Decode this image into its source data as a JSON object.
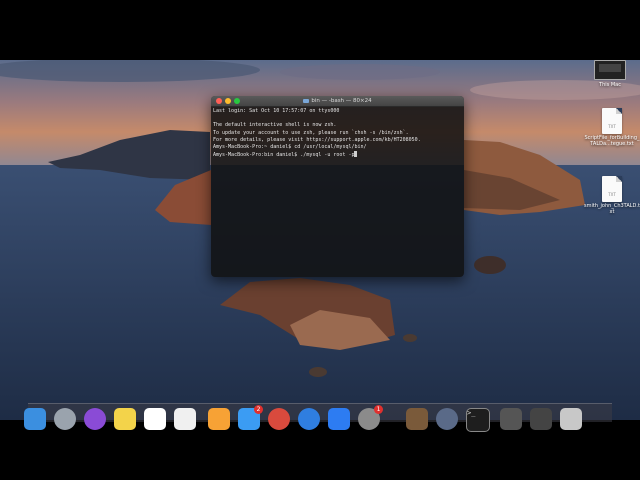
{
  "terminal": {
    "title": "bin — -bash — 80×24",
    "lines": [
      "Last login: Sat Oct 10 17:57:07 on ttys000",
      "",
      "The default interactive shell is now zsh.",
      "To update your account to use zsh, please run `chsh -s /bin/zsh`.",
      "For more details, please visit https://support.apple.com/kb/HT208050.",
      "Amys-MacBook-Pro:~ daniel$ cd /usr/local/mysql/bin/",
      "Amys-MacBook-Pro:bin daniel$ ./mysql -u root -p"
    ]
  },
  "desktop_icons": [
    {
      "label": "This Mac",
      "icon": "computer-icon"
    },
    {
      "label": "ScriptFile_forBuilding_TALDa...tegue.txt",
      "icon": "text-file-icon",
      "badge": "TXT"
    },
    {
      "label": "smith_john_Ch3TALD.txt",
      "icon": "text-file-icon",
      "badge": "TXT"
    }
  ],
  "dock": {
    "items": [
      {
        "name": "finder",
        "color": "#3b8fe0"
      },
      {
        "name": "launchpad",
        "color": "#9aa3ad"
      },
      {
        "name": "siri",
        "color": "#8a4bd6"
      },
      {
        "name": "notes",
        "color": "#f3d34a"
      },
      {
        "name": "calendar",
        "color": "#ffffff"
      },
      {
        "name": "reminders",
        "color": "#f0f0f0"
      },
      {
        "name": "photos",
        "color": "#f7a235"
      },
      {
        "name": "messages",
        "color": "#3b9cf3",
        "badge": "2"
      },
      {
        "name": "chrome",
        "color": "#d94a3d"
      },
      {
        "name": "safari",
        "color": "#2f7ee0"
      },
      {
        "name": "app-store",
        "color": "#2d7cf2"
      },
      {
        "name": "system-preferences",
        "color": "#8b8b8b",
        "badge": "1"
      },
      {
        "name": "utility",
        "color": "#7a5a3a"
      },
      {
        "name": "quicktime",
        "color": "#5a6a88"
      },
      {
        "name": "terminal",
        "color": "#1e1e1e"
      },
      {
        "name": "downloads-stack",
        "color": "#555555"
      },
      {
        "name": "documents-stack",
        "color": "#444444"
      },
      {
        "name": "trash",
        "color": "#c8c8c8"
      }
    ]
  }
}
